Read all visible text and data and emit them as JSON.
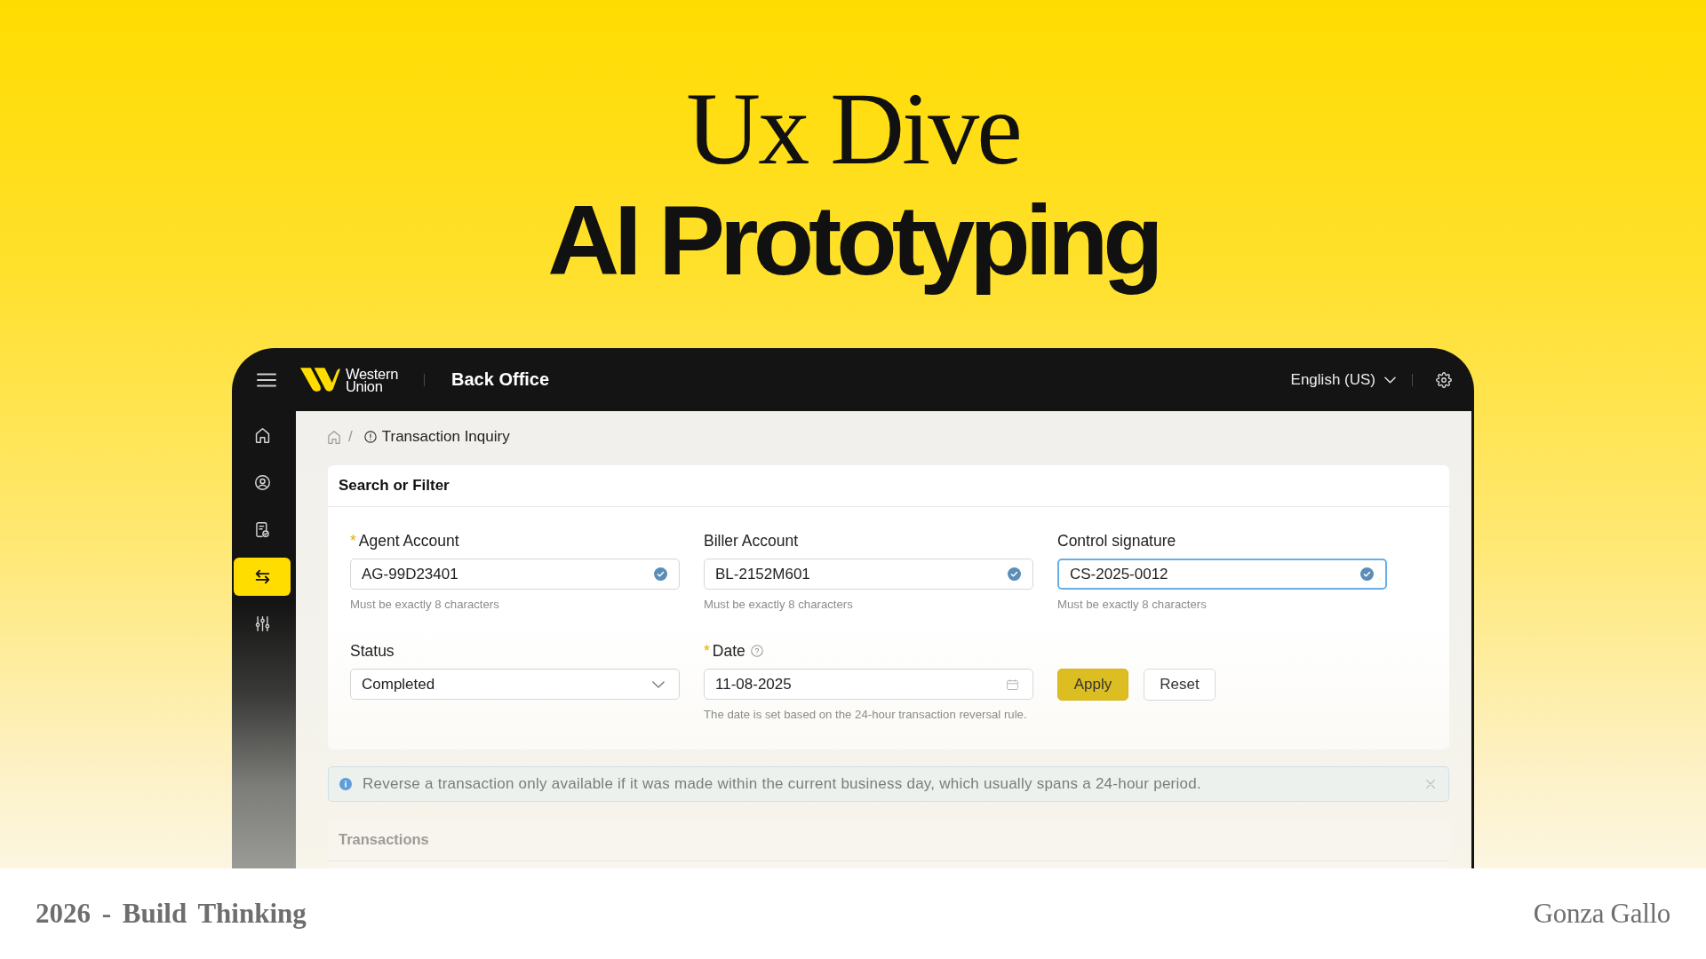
{
  "hero": {
    "title": "Ux Dive",
    "subtitle": "AI Prototyping"
  },
  "app": {
    "header": {
      "logo": {
        "lines": [
          "Western",
          "Union"
        ]
      },
      "title": "Back Office",
      "language": "English (US)"
    },
    "sidebar": {
      "items": [
        {
          "selected": false
        },
        {
          "selected": false
        },
        {
          "selected": false
        },
        {
          "selected": true
        },
        {
          "selected": false
        }
      ]
    },
    "breadcrumb": {
      "separator": "/",
      "current": "Transaction Inquiry"
    },
    "search_card": {
      "title": "Search or Filter",
      "fields": [
        {
          "kind": "text",
          "label": "Agent Account",
          "required_mark": "*",
          "value": "AG-99D23401",
          "valid": true,
          "focused": false,
          "hint_icon": false,
          "help": "Must be exactly 8 characters"
        },
        {
          "kind": "text",
          "label": "Biller Account",
          "value": "BL-2152M601",
          "valid": true,
          "focused": false,
          "hint_icon": false,
          "help": "Must be exactly 8 characters"
        },
        {
          "kind": "text",
          "label": "Control signature",
          "value": "CS-2025-0012",
          "valid": true,
          "focused": true,
          "hint_icon": false,
          "help": "Must be exactly 8 characters"
        },
        {
          "kind": "select",
          "label": "Status",
          "value": "Completed",
          "valid": false,
          "focused": false,
          "hint_icon": false
        },
        {
          "kind": "date",
          "label": "Date",
          "required_mark": "*",
          "value": "11-08-2025",
          "valid": false,
          "focused": false,
          "hint_icon": true,
          "help": "The date is set based on the 24-hour transaction reversal rule."
        }
      ],
      "buttons": [
        {
          "kind": "primary",
          "label": "Apply"
        },
        {
          "kind": "secondary",
          "label": "Reset"
        }
      ]
    },
    "alert": {
      "text": "Reverse a transaction only available if it was made within the current business day, which usually spans a 24-hour period.",
      "dismissible": true
    },
    "transactions": {
      "title": "Transactions"
    }
  },
  "footer": {
    "left": "2026 - Build Thinking",
    "right": "Gonza Gallo"
  }
}
